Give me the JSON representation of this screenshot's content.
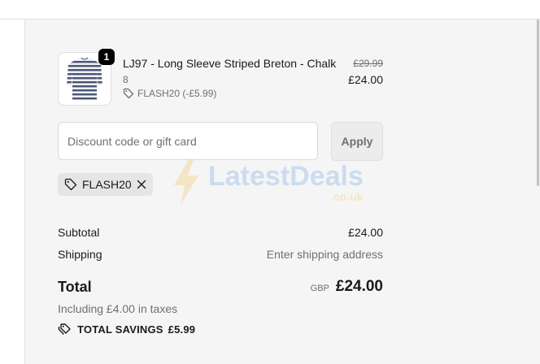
{
  "product": {
    "quantity": "1",
    "name": "LJ97 - Long Sleeve Striped Breton - Chalk",
    "variant": "8",
    "discount_line": "FLASH20 (-£5.99)",
    "original_price": "£29.99",
    "price": "£24.00"
  },
  "discount": {
    "placeholder": "Discount code or gift card",
    "apply_label": "Apply",
    "applied_code": "FLASH20"
  },
  "summary": {
    "subtotal_label": "Subtotal",
    "subtotal_value": "£24.00",
    "shipping_label": "Shipping",
    "shipping_value": "Enter shipping address",
    "total_label": "Total",
    "currency": "GBP",
    "total_value": "£24.00",
    "taxes_note": "Including £4.00 in taxes",
    "savings_label": "TOTAL SAVINGS",
    "savings_value": "£5.99"
  },
  "watermark": {
    "brand": "LatestDeals",
    "tld": ".co.uk"
  },
  "icons": {
    "tag": "tag-icon",
    "close": "close-icon",
    "savings": "savings-tag-icon"
  },
  "colors": {
    "panel_background": "#f5f5f5",
    "quantity_badge": "#000000",
    "chip_background": "#e5e5e5",
    "muted_text": "#707070"
  }
}
